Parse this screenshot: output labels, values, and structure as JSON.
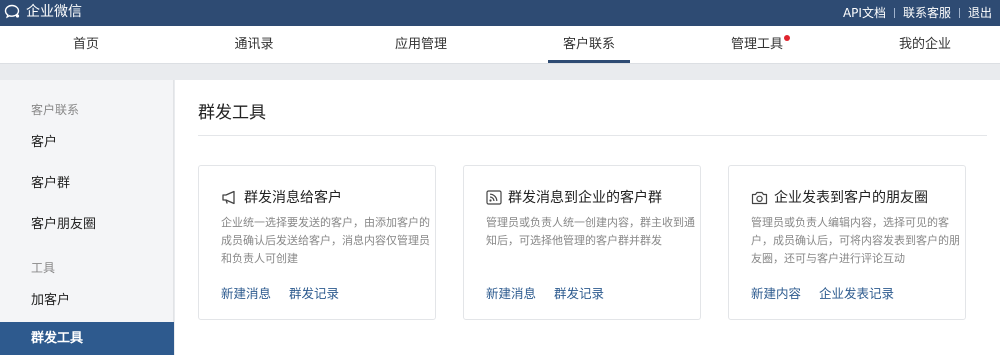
{
  "app": {
    "title": "企业微信"
  },
  "toplinks": [
    "API文档",
    "联系客服",
    "退出"
  ],
  "nav": {
    "items": [
      "首页",
      "通讯录",
      "应用管理",
      "客户联系",
      "管理工具",
      "我的企业"
    ],
    "active_index": 3,
    "badge_index": 4
  },
  "sidebar": {
    "group1": "客户联系",
    "items1": [
      "客户",
      "客户群",
      "客户朋友圈"
    ],
    "group2": "工具",
    "items2": [
      "加客户",
      "群发工具"
    ],
    "active_label": "群发工具"
  },
  "main": {
    "title": "群发工具",
    "cards": [
      {
        "icon": "megaphone-icon",
        "title": "群发消息给客户",
        "desc": "企业统一选择要发送的客户，由添加客户的成员确认后发送给客户，消息内容仅管理员和负责人可创建",
        "actions": [
          "新建消息",
          "群发记录"
        ]
      },
      {
        "icon": "broadcast-icon",
        "title": "群发消息到企业的客户群",
        "desc": "管理员或负责人统一创建内容，群主收到通知后，可选择他管理的客户群并群发",
        "actions": [
          "新建消息",
          "群发记录"
        ]
      },
      {
        "icon": "camera-icon",
        "title": "企业发表到客户的朋友圈",
        "desc": "管理员或负责人编辑内容，选择可见的客户，成员确认后，可将内容发表到客户的朋友圈，还可与客户进行评论互动",
        "actions": [
          "新建内容",
          "企业发表记录"
        ]
      }
    ]
  },
  "colors": {
    "topbar": "#2e4b73",
    "accent": "#2e5a8e",
    "link": "#2d5b8f",
    "badge": "#e0232d"
  }
}
